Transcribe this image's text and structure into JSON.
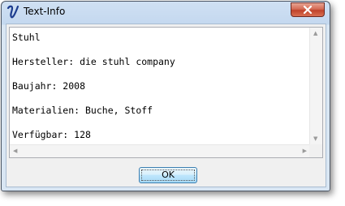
{
  "window": {
    "title": "Text-Info",
    "app_icon": "curly-v-icon",
    "close_icon": "close-icon"
  },
  "content": {
    "lines": [
      "Stuhl",
      "Hersteller: die stuhl company",
      "Baujahr: 2008",
      "Materialien: Buche, Stoff",
      "Verfügbar: 128"
    ]
  },
  "buttons": {
    "ok_label": "OK"
  },
  "colors": {
    "close_button": "#c0432a",
    "title_bar": "#c4d8ef"
  }
}
